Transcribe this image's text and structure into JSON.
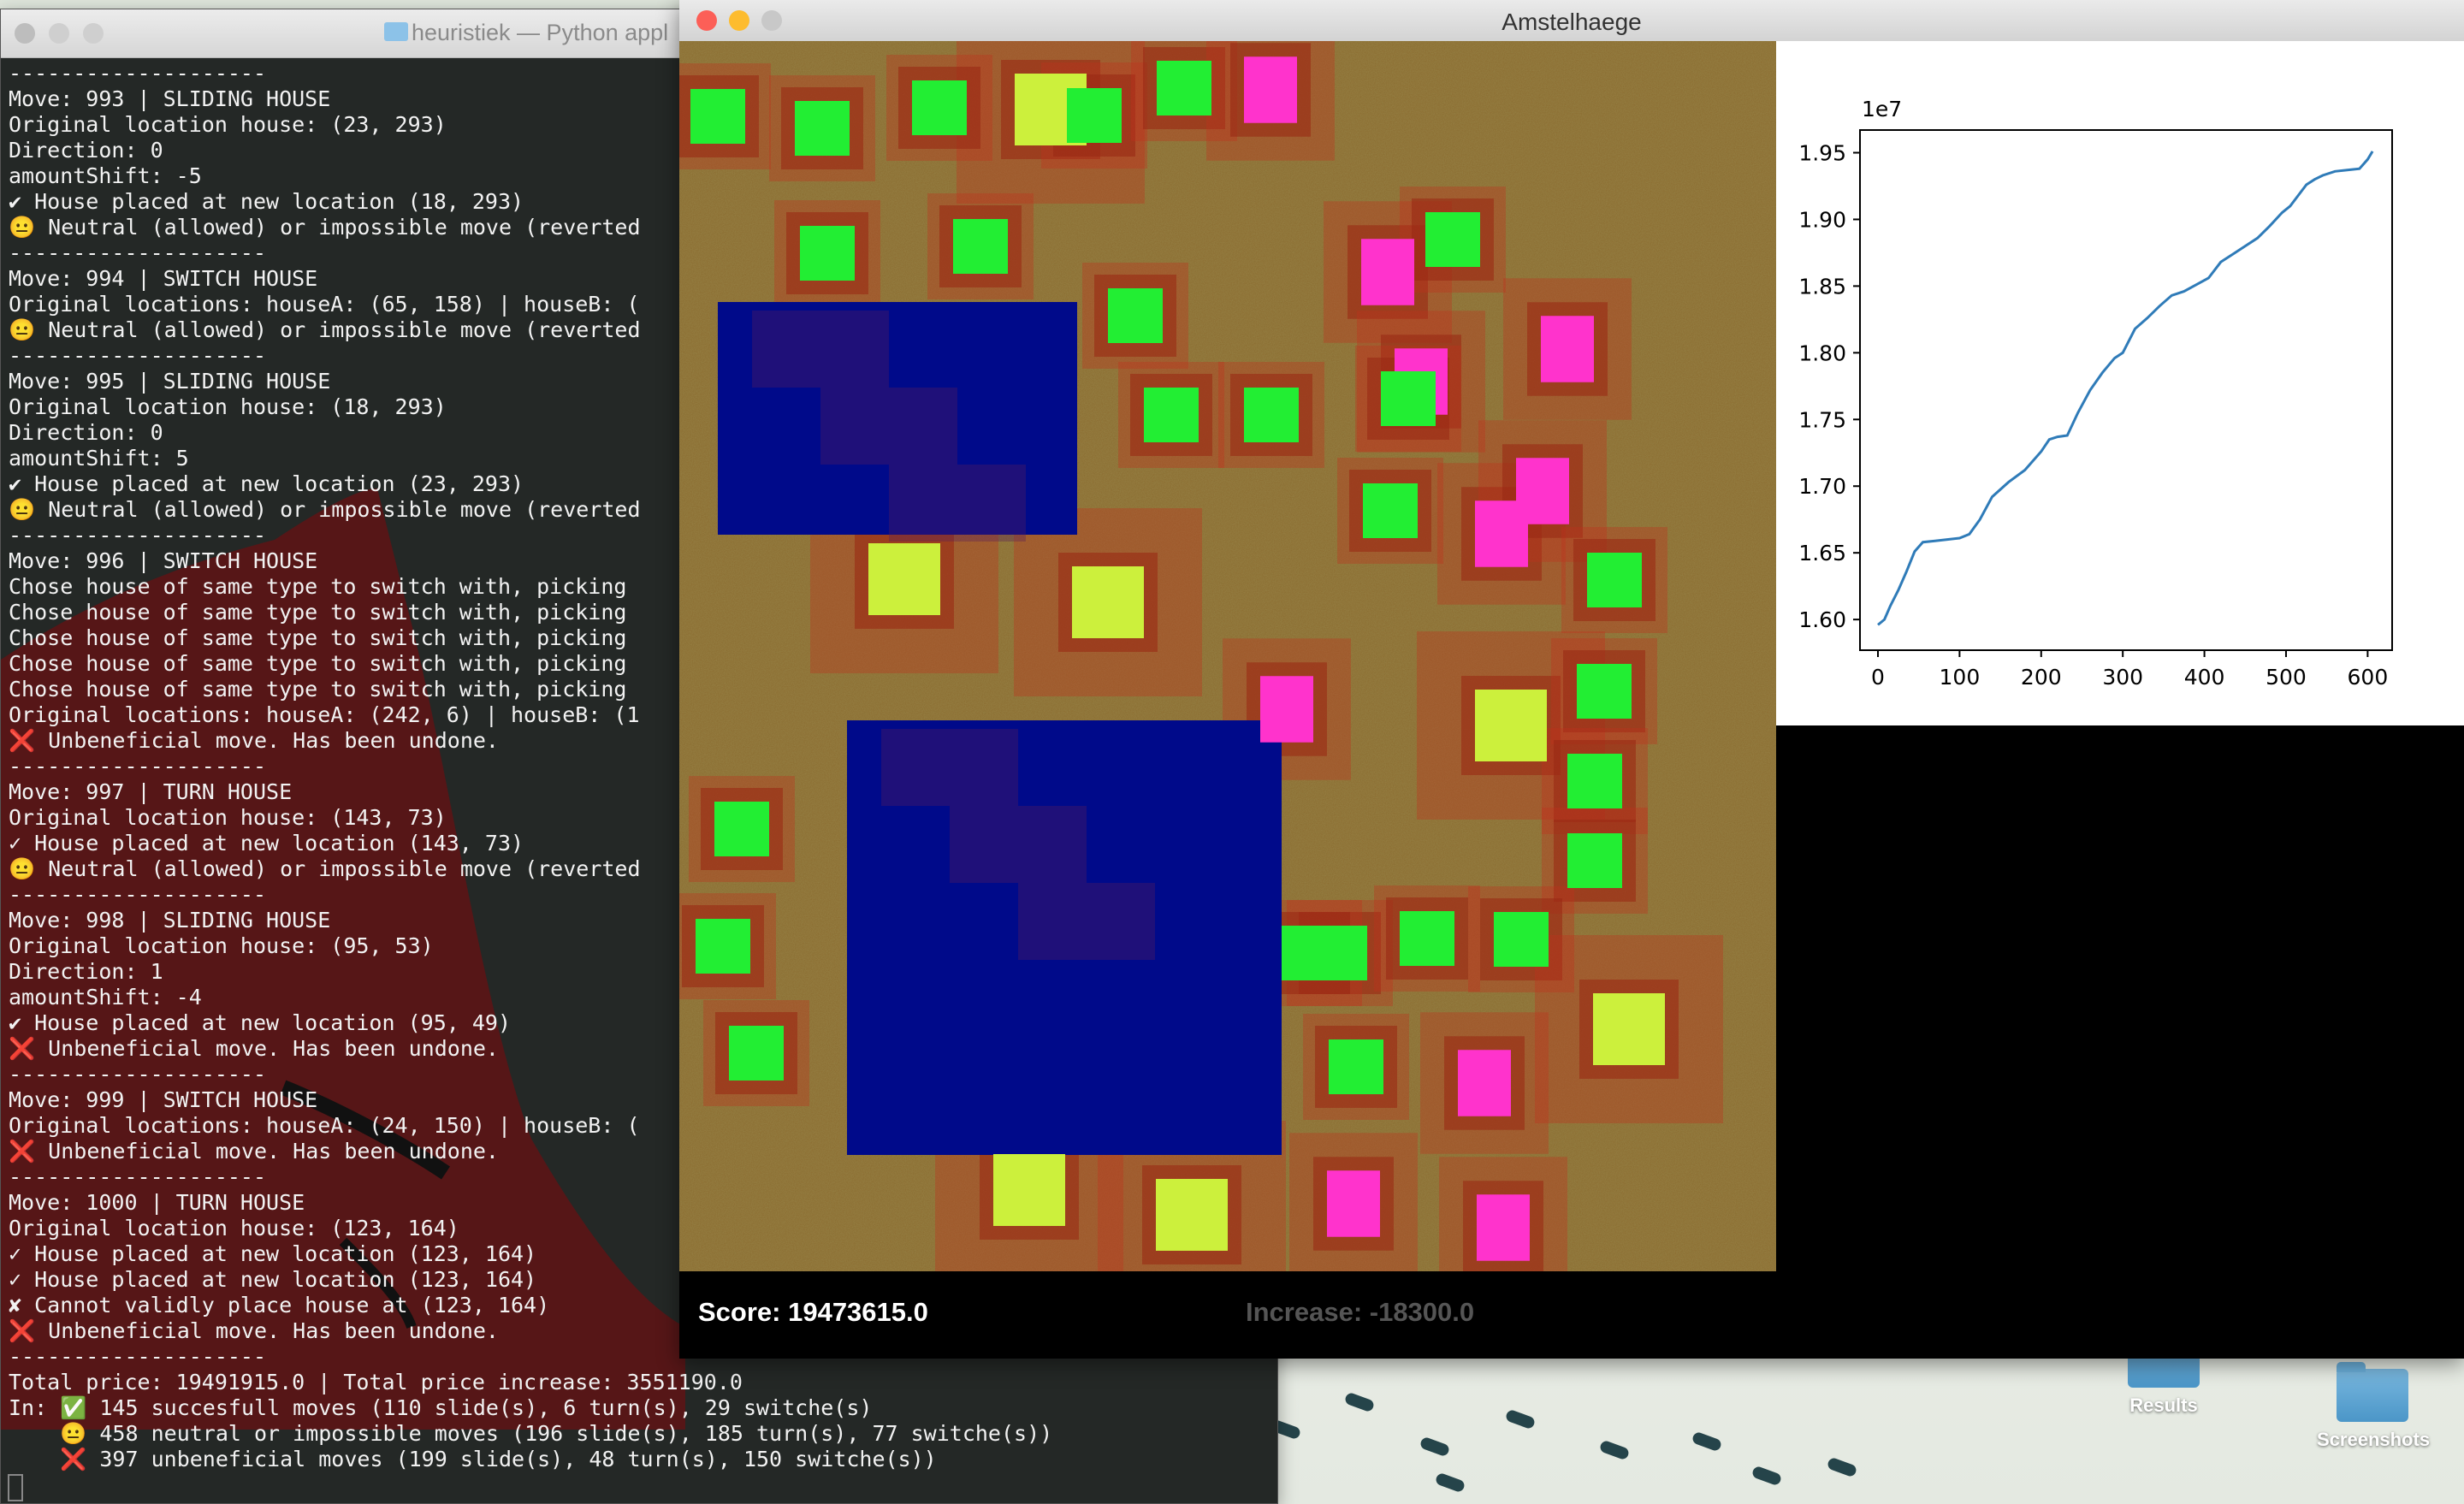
{
  "terminal": {
    "title": "heuristiek — Python appl",
    "lines": [
      "--------------------",
      "Move: 993 | SLIDING HOUSE",
      "Original location house: (23, 293)",
      "Direction: 0",
      "amountShift: -5",
      "✔ House placed at new location (18, 293)",
      "😐 Neutral (allowed) or impossible move (reverted",
      "--------------------",
      "Move: 994 | SWITCH HOUSE",
      "Original locations: houseA: (65, 158) | houseB: (",
      "😐 Neutral (allowed) or impossible move (reverted",
      "--------------------",
      "Move: 995 | SLIDING HOUSE",
      "Original location house: (18, 293)",
      "Direction: 0",
      "amountShift: 5",
      "✔ House placed at new location (23, 293)",
      "😐 Neutral (allowed) or impossible move (reverted",
      "--------------------",
      "Move: 996 | SWITCH HOUSE",
      "Chose house of same type to switch with, picking",
      "Chose house of same type to switch with, picking",
      "Chose house of same type to switch with, picking",
      "Chose house of same type to switch with, picking",
      "Chose house of same type to switch with, picking",
      "Original locations: houseA: (242, 6) | houseB: (1",
      "❌ Unbeneficial move. Has been undone.",
      "--------------------",
      "Move: 997 | TURN HOUSE",
      "Original location house: (143, 73)",
      "✓ House placed at new location (143, 73)",
      "😐 Neutral (allowed) or impossible move (reverted",
      "--------------------",
      "Move: 998 | SLIDING HOUSE",
      "Original location house: (95, 53)",
      "Direction: 1",
      "amountShift: -4",
      "✔ House placed at new location (95, 49)",
      "❌ Unbeneficial move. Has been undone.",
      "--------------------",
      "Move: 999 | SWITCH HOUSE",
      "Original locations: houseA: (24, 150) | houseB: (",
      "❌ Unbeneficial move. Has been undone.",
      "--------------------",
      "Move: 1000 | TURN HOUSE",
      "Original location house: (123, 164)",
      "✓ House placed at new location (123, 164)",
      "✓ House placed at new location (123, 164)",
      "✘ Cannot validly place house at (123, 164)",
      "❌ Unbeneficial move. Has been undone.",
      "--------------------",
      "Total price: 19491915.0 | Total price increase: 3551190.0",
      "In: ✅ 145 succesfull moves (110 slide(s), 6 turn(s), 29 switche(s)",
      "    😐 458 neutral or impossible moves (196 slide(s), 185 turn(s), 77 switche(s))",
      "    ❌ 397 unbeneficial moves (199 slide(s), 48 turn(s), 150 switche(s))"
    ]
  },
  "amstel": {
    "title": "Amstelhaege",
    "score": "Score: 19473615.0",
    "increase": "Increase: -18300.0"
  },
  "desktop": {
    "icons": [
      {
        "label": "Results",
        "icon": "folder-icon"
      },
      {
        "label": "Screenshots",
        "icon": "folder-icon"
      }
    ]
  },
  "colors": {
    "water": "#000a8a",
    "single_family": "#22ee33",
    "bungalow": "#ff33cc",
    "maison": "#ccf03c",
    "series": "#2f7bb8"
  },
  "map_data": {
    "water": [
      [
        45,
        305,
        420,
        272
      ],
      [
        196,
        794,
        508,
        508
      ]
    ],
    "houses": [
      {
        "t": "g",
        "c": [
          45,
          88
        ]
      },
      {
        "t": "g",
        "c": [
          167,
          102
        ]
      },
      {
        "t": "m",
        "c": [
          434,
          80
        ]
      },
      {
        "t": "g",
        "c": [
          304,
          78
        ]
      },
      {
        "t": "g",
        "c": [
          485,
          87
        ]
      },
      {
        "t": "g",
        "c": [
          590,
          55
        ]
      },
      {
        "t": "p",
        "c": [
          691,
          57
        ]
      },
      {
        "t": "g",
        "c": [
          173,
          248
        ]
      },
      {
        "t": "g",
        "c": [
          352,
          240
        ]
      },
      {
        "t": "p",
        "c": [
          828,
          270
        ]
      },
      {
        "t": "g",
        "c": [
          533,
          321
        ]
      },
      {
        "t": "g",
        "c": [
          904,
          232
        ]
      },
      {
        "t": "p",
        "c": [
          867,
          398
        ]
      },
      {
        "t": "g",
        "c": [
          575,
          437
        ]
      },
      {
        "t": "g",
        "c": [
          692,
          437
        ]
      },
      {
        "t": "g",
        "c": [
          852,
          418
        ]
      },
      {
        "t": "p",
        "c": [
          1038,
          360
        ]
      },
      {
        "t": "g",
        "c": [
          831,
          549
        ]
      },
      {
        "t": "p",
        "c": [
          961,
          576
        ]
      },
      {
        "t": "p",
        "c": [
          1009,
          526
        ]
      },
      {
        "t": "m",
        "c": [
          263,
          629
        ]
      },
      {
        "t": "m",
        "c": [
          501,
          656
        ]
      },
      {
        "t": "g",
        "c": [
          1093,
          630
        ]
      },
      {
        "t": "p",
        "c": [
          710,
          781
        ]
      },
      {
        "t": "m",
        "c": [
          972,
          800
        ]
      },
      {
        "t": "g",
        "c": [
          1081,
          760
        ]
      },
      {
        "t": "g",
        "c": [
          73,
          921
        ]
      },
      {
        "t": "g",
        "c": [
          1070,
          865
        ]
      },
      {
        "t": "g",
        "c": [
          1070,
          958
        ]
      },
      {
        "t": "g",
        "c": [
          51,
          1058
        ]
      },
      {
        "t": "g",
        "c": [
          772,
          1066
        ]
      },
      {
        "t": "g",
        "c": [
          874,
          1049
        ]
      },
      {
        "t": "g",
        "c": [
          736,
          1066
        ]
      },
      {
        "t": "g",
        "c": [
          984,
          1050
        ]
      },
      {
        "t": "m",
        "c": [
          1110,
          1155
        ]
      },
      {
        "t": "g",
        "c": [
          90,
          1183
        ]
      },
      {
        "t": "g",
        "c": [
          791,
          1199
        ]
      },
      {
        "t": "p",
        "c": [
          941,
          1218
        ]
      },
      {
        "t": "m",
        "c": [
          409,
          1343
        ]
      },
      {
        "t": "m",
        "c": [
          599,
          1372
        ]
      },
      {
        "t": "p",
        "c": [
          788,
          1359
        ]
      },
      {
        "t": "p",
        "c": [
          963,
          1387
        ]
      }
    ]
  },
  "chart_data": {
    "type": "line",
    "offset_text": "1e7",
    "xlim": [
      -22,
      630
    ],
    "ylim": [
      1.577,
      1.967
    ],
    "xticks": [
      0,
      100,
      200,
      300,
      400,
      500,
      600
    ],
    "yticks": [
      1.6,
      1.65,
      1.7,
      1.75,
      1.8,
      1.85,
      1.9,
      1.95
    ],
    "ytick_labels": [
      "1.60",
      "1.65",
      "1.70",
      "1.75",
      "1.80",
      "1.85",
      "1.90",
      "1.95"
    ],
    "series": [
      {
        "x": [
          0,
          8,
          15,
          25,
          35,
          45,
          55,
          70,
          85,
          100,
          112,
          125,
          140,
          160,
          180,
          200,
          210,
          220,
          232,
          245,
          260,
          275,
          290,
          300,
          315,
          330,
          345,
          360,
          375,
          390,
          405,
          420,
          435,
          450,
          465,
          480,
          495,
          505,
          515,
          525,
          535,
          545,
          560,
          575,
          590,
          600,
          606
        ],
        "y": [
          1.596,
          1.6,
          1.61,
          1.622,
          1.636,
          1.651,
          1.658,
          1.659,
          1.66,
          1.661,
          1.664,
          1.675,
          1.692,
          1.703,
          1.712,
          1.726,
          1.735,
          1.737,
          1.738,
          1.755,
          1.772,
          1.785,
          1.796,
          1.8,
          1.818,
          1.826,
          1.835,
          1.843,
          1.846,
          1.851,
          1.856,
          1.868,
          1.874,
          1.88,
          1.886,
          1.895,
          1.905,
          1.91,
          1.918,
          1.926,
          1.93,
          1.933,
          1.936,
          1.937,
          1.938,
          1.945,
          1.951
        ]
      }
    ]
  }
}
